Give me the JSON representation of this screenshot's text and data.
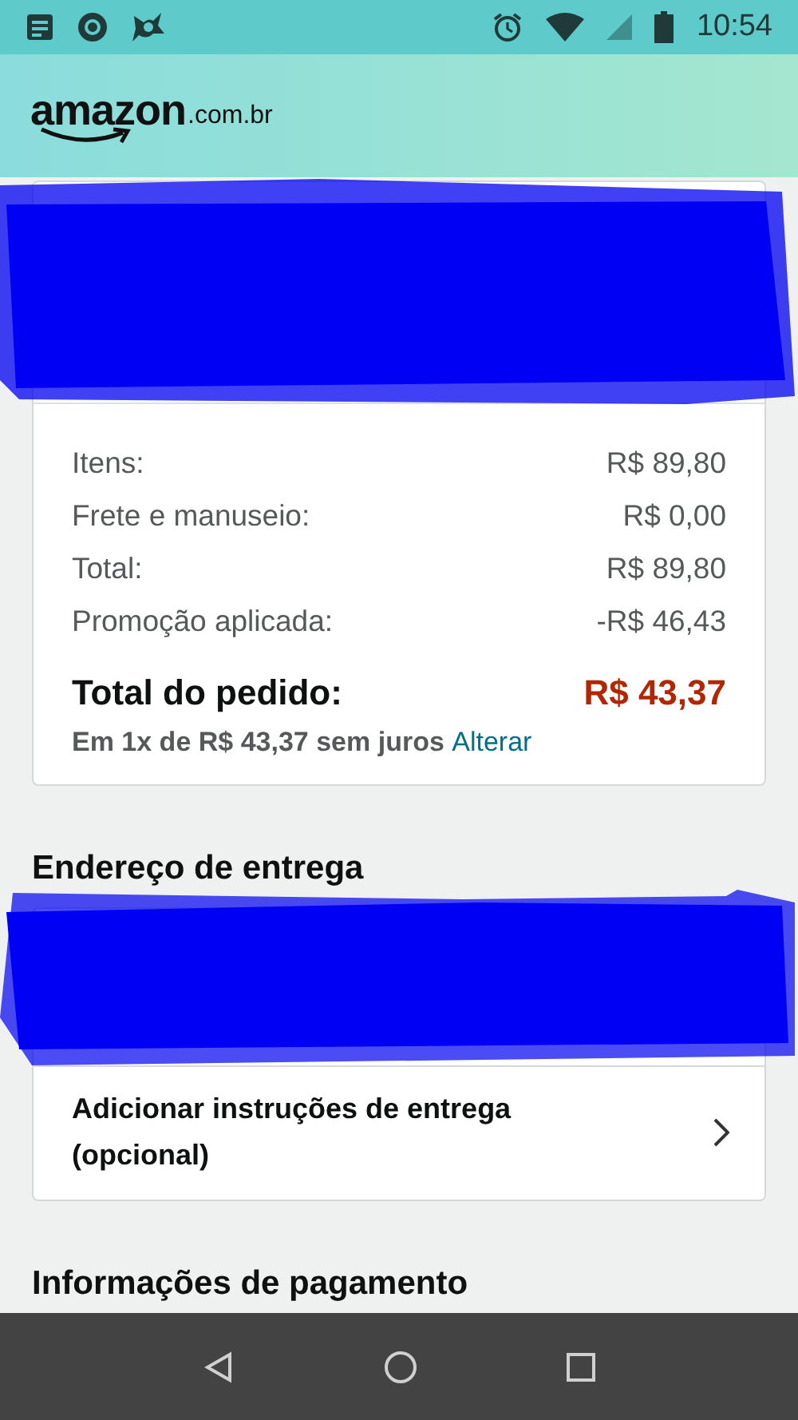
{
  "status_bar": {
    "time": "10:54"
  },
  "header": {
    "logo": "amazon",
    "logo_suffix": ".com.br"
  },
  "order_summary": {
    "rows": [
      {
        "label": "Itens:",
        "value": "R$ 89,80"
      },
      {
        "label": "Frete e manuseio:",
        "value": "R$ 0,00"
      },
      {
        "label": "Total:",
        "value": "R$ 89,80"
      },
      {
        "label": "Promoção aplicada:",
        "value": "-R$ 46,43"
      }
    ],
    "total": {
      "label": "Total do pedido:",
      "value": "R$ 43,37"
    },
    "installments": {
      "text": "Em 1x de R$ 43,37 sem juros",
      "link": "Alterar"
    }
  },
  "delivery": {
    "heading": "Endereço de entrega",
    "instructions": "Adicionar instruções de entrega (opcional)"
  },
  "payment": {
    "heading": "Informações de pagamento"
  }
}
